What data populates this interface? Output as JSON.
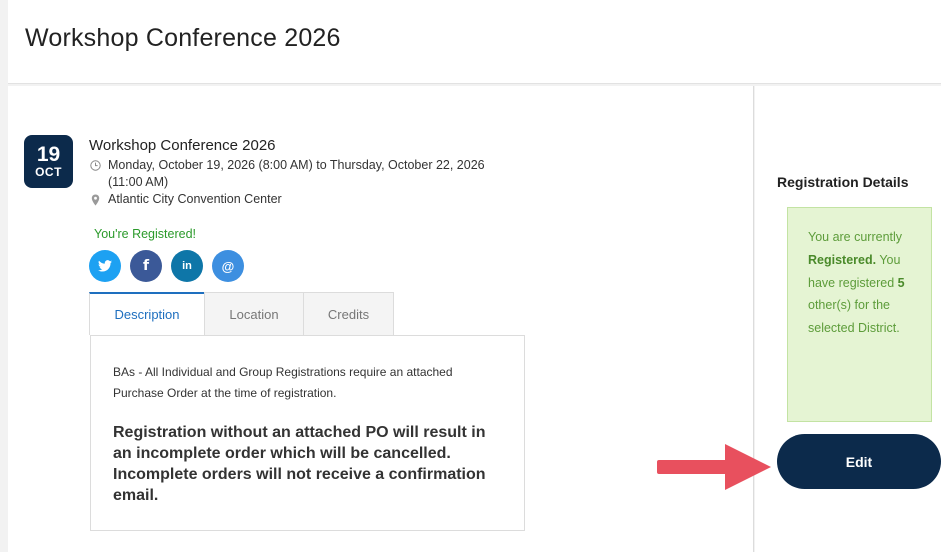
{
  "header": {
    "title": "Workshop Conference 2026"
  },
  "event": {
    "day": "19",
    "month": "OCT",
    "title": "Workshop Conference 2026",
    "datetime": "Monday, October 19, 2026 (8:00 AM) to Thursday, October 22, 2026 (11:00 AM)",
    "location": "Atlantic City Convention Center",
    "status": "You're Registered!"
  },
  "share": {
    "twitter_icon": "f",
    "facebook_icon": "f",
    "linkedin_icon": "in",
    "email_icon": "@"
  },
  "tabs": [
    {
      "label": "Description"
    },
    {
      "label": "Location"
    },
    {
      "label": "Credits"
    }
  ],
  "description": {
    "p1": "BAs - All Individual and Group Registrations require an attached Purchase Order at the time of registration.",
    "p2": "Registration without an attached PO will result in an incomplete order which will be cancelled. Incomplete orders will not receive a confirmation email."
  },
  "registration": {
    "title": "Registration Details",
    "line1": "You are currently",
    "registered": "Registered.",
    "line2": "You have registered",
    "count": "5",
    "line3": "other(s) for the selected District.",
    "edit_label": "Edit"
  },
  "colors": {
    "navy": "#0c2a4b",
    "twitter": "#1da1f2",
    "facebook": "#3b5998",
    "linkedin": "#0e76a8",
    "email": "#3d8fe0",
    "registered_green": "#2b9a2b",
    "arrow": "#e8505e"
  }
}
